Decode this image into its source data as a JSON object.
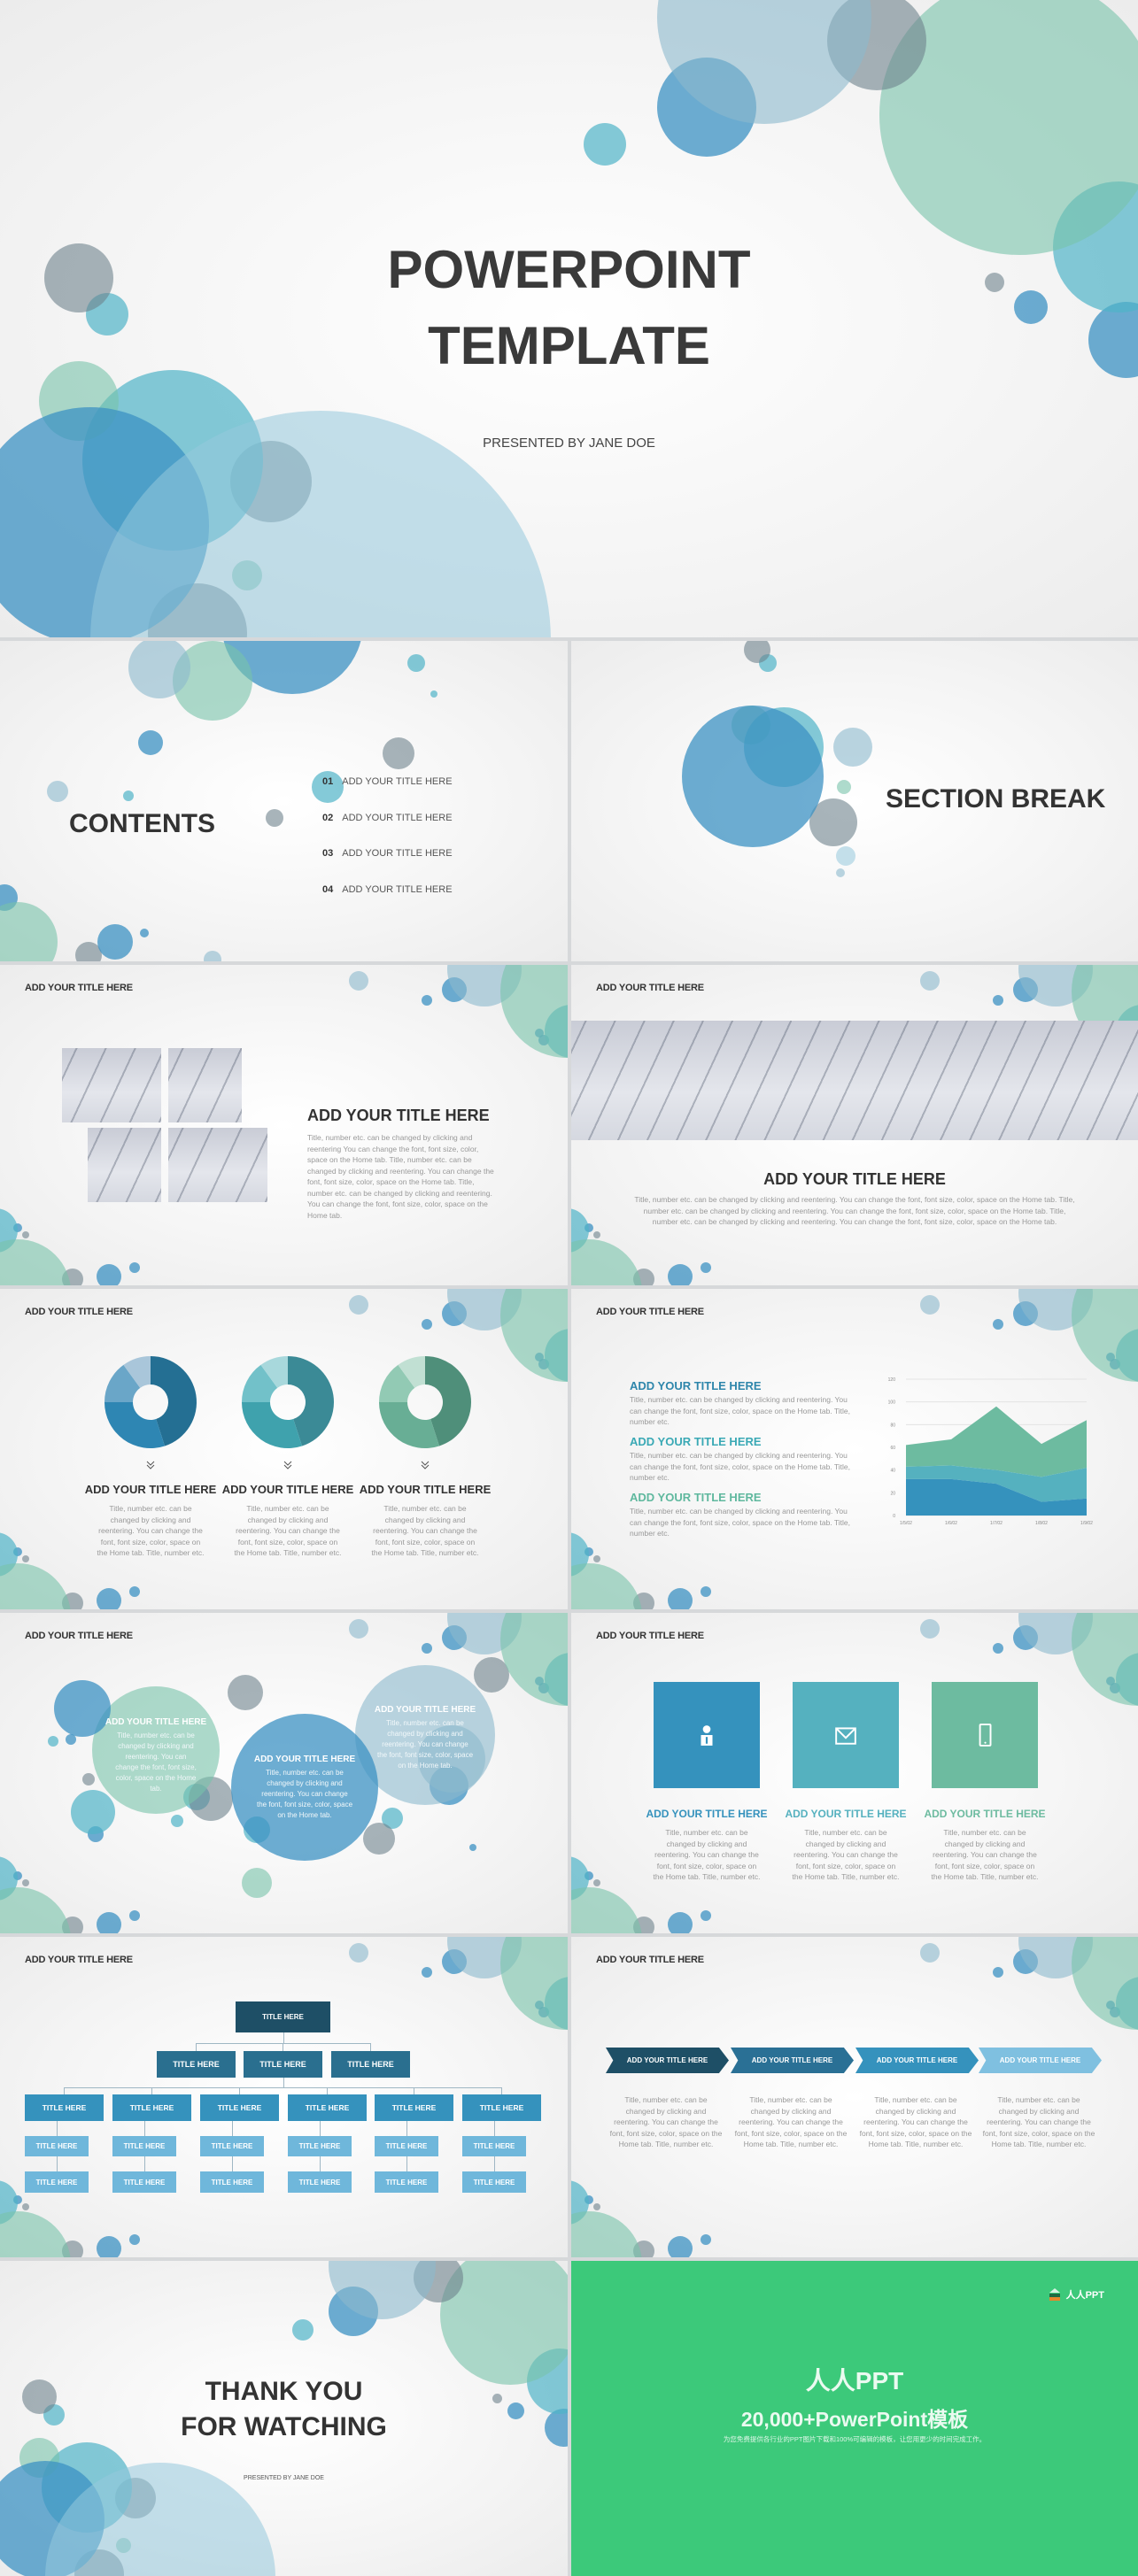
{
  "colors": {
    "blue": "#3592bd",
    "teal": "#55b1bf",
    "green": "#6dbba0",
    "dark": "#1e4f66",
    "brand_green": "#3cc97a"
  },
  "cover": {
    "title_line1": "POWERPOINT",
    "title_line2": "TEMPLATE",
    "presenter": "PRESENTED BY JANE DOE"
  },
  "contents": {
    "title": "CONTENTS",
    "items": [
      {
        "num": "01",
        "label": "ADD YOUR TITLE HERE"
      },
      {
        "num": "02",
        "label": "ADD YOUR TITLE HERE"
      },
      {
        "num": "03",
        "label": "ADD YOUR TITLE HERE"
      },
      {
        "num": "04",
        "label": "ADD YOUR TITLE HERE"
      }
    ]
  },
  "section": {
    "title": "SECTION BREAK"
  },
  "slide_header": "ADD YOUR TITLE HERE",
  "photos_slide": {
    "title": "ADD YOUR TITLE HERE",
    "body": "Title, number etc. can be changed by clicking and reentering You can change the font, font size, color, space on the Home tab. Title, number etc. can be changed by clicking and reentering. You can change the font, font size, color, space on the Home tab. Title, number etc. can be changed by clicking and reentering. You can change the font, font size, color, space on the Home tab."
  },
  "banner_slide": {
    "title": "ADD YOUR TITLE HERE",
    "body": "Title, number etc. can be changed by clicking and reentering. You can change the font, font size, color, space on the Home tab. Title, number etc. can be changed by clicking and reentering. You can change the font, font size, color, space on the Home tab. Title, number etc. can be changed by clicking and reentering. You can change the font, font size, color, space on the Home tab."
  },
  "donut_slide": {
    "items": [
      {
        "title": "ADD YOUR TITLE HERE",
        "body": "Title, number etc. can be changed by clicking and reentering. You can change the font, font size, color, space on the Home tab. Title, number etc.",
        "palette": [
          "#246f93",
          "#2e86b3",
          "#6aa6c8",
          "#a9c6da"
        ]
      },
      {
        "title": "ADD YOUR TITLE HERE",
        "body": "Title, number etc. can be changed by clicking and reentering. You can change the font, font size, color, space on the Home tab. Title, number etc.",
        "palette": [
          "#3b8a96",
          "#3fa2ad",
          "#72c1c9",
          "#a8d8dc"
        ]
      },
      {
        "title": "ADD YOUR TITLE HERE",
        "body": "Title, number etc. can be changed by clicking and reentering. You can change the font, font size, color, space on the Home tab. Title, number etc.",
        "palette": [
          "#4f8f7a",
          "#68ae95",
          "#92cab4",
          "#c1e0d3"
        ]
      }
    ]
  },
  "chart_slide": {
    "items": [
      {
        "title": "ADD YOUR TITLE HERE",
        "body": "Title, number etc. can be changed by clicking and reentering. You can change the font, font size, color, space on the Home tab. Title, number etc.",
        "color": "#2e86ab"
      },
      {
        "title": "ADD YOUR TITLE HERE",
        "body": "Title, number etc. can be changed by clicking and reentering. You can change the font, font size, color, space on the Home tab. Title, number etc.",
        "color": "#3aa9b5"
      },
      {
        "title": "ADD YOUR TITLE HERE",
        "body": "Title, number etc. can be changed by clicking and reentering. You can change the font, font size, color, space on the Home tab. Title, number etc.",
        "color": "#5fb89e"
      }
    ]
  },
  "chart_data": [
    {
      "type": "pie",
      "variant": "donut",
      "values": [
        45,
        30,
        15,
        10
      ],
      "count": 3
    },
    {
      "type": "area",
      "stacked": true,
      "categories": [
        "1/5/02",
        "1/6/02",
        "1/7/02",
        "1/8/02",
        "1/9/02"
      ],
      "series": [
        {
          "values": [
            32,
            32,
            28,
            12,
            15
          ],
          "color": "#3592bd"
        },
        {
          "values": [
            11,
            12,
            12,
            22,
            27
          ],
          "color": "#55b1bf"
        },
        {
          "values": [
            19,
            23,
            56,
            29,
            42
          ],
          "color": "#6dbba0"
        }
      ],
      "ylim": [
        0,
        120
      ],
      "yticks": [
        "0",
        "20",
        "40",
        "60",
        "80",
        "100",
        "120"
      ],
      "grid": true
    }
  ],
  "bubble_slide": {
    "items": [
      {
        "title": "ADD YOUR TITLE HERE",
        "body": "Title, number etc. can be changed by clicking and reentering. You can change the font, font size, color, space on the Home tab."
      },
      {
        "title": "ADD YOUR TITLE HERE",
        "body": "Title, number etc. can be changed by clicking and reentering. You can change the font, font size, color, space on the Home tab."
      },
      {
        "title": "ADD YOUR TITLE HERE",
        "body": "Title, number etc. can be changed by clicking and reentering. You can change the font, font size, color, space on the Home tab."
      }
    ]
  },
  "icon_slide": {
    "items": [
      {
        "icon": "person-icon",
        "title": "ADD YOUR TITLE HERE",
        "body": "Title, number etc. can be changed by clicking and reentering. You can change the font, font size, color, space on the Home tab. Title, number etc.",
        "color": "#3592bd"
      },
      {
        "icon": "mail-icon",
        "title": "ADD YOUR TITLE HERE",
        "body": "Title, number etc. can be changed by clicking and reentering. You can change the font, font size, color, space on the Home tab. Title, number etc.",
        "color": "#55b1bf"
      },
      {
        "icon": "phone-icon",
        "title": "ADD YOUR TITLE HERE",
        "body": "Title, number etc. can be changed by clicking and reentering. You can change the font, font size, color, space on the Home tab. Title, number etc.",
        "color": "#6dbba0"
      }
    ]
  },
  "org_chart": {
    "node_label": "TITLE HERE",
    "levels": [
      1,
      3,
      6,
      6,
      6
    ]
  },
  "process_slide": {
    "items": [
      {
        "label": "ADD YOUR TITLE HERE",
        "body": "Title, number etc. can be changed by clicking and reentering. You can change the font, font size, color, space on the Home tab. Title, number etc.",
        "color": "#1e4f66"
      },
      {
        "label": "ADD YOUR TITLE HERE",
        "body": "Title, number etc. can be changed by clicking and reentering. You can change the font, font size, color, space on the Home tab. Title, number etc.",
        "color": "#2a7095"
      },
      {
        "label": "ADD YOUR TITLE HERE",
        "body": "Title, number etc. can be changed by clicking and reentering. You can change the font, font size, color, space on the Home tab. Title, number etc.",
        "color": "#3592bd"
      },
      {
        "label": "ADD YOUR TITLE HERE",
        "body": "Title, number etc. can be changed by clicking and reentering. You can change the font, font size, color, space on the Home tab. Title, number etc.",
        "color": "#7fc0e0"
      }
    ]
  },
  "thanks": {
    "line1": "THANK YOU",
    "line2": "FOR WATCHING",
    "presenter": "PRESENTED BY JANE DOE"
  },
  "promo": {
    "logo_text": "人人PPT",
    "title": "人人PPT",
    "subtitle": "20,000+PowerPoint模板",
    "tagline": "为您免费提供各行业的PPT图片下载和100%可编辑的模板，让您用更少的时间完成工作。"
  }
}
